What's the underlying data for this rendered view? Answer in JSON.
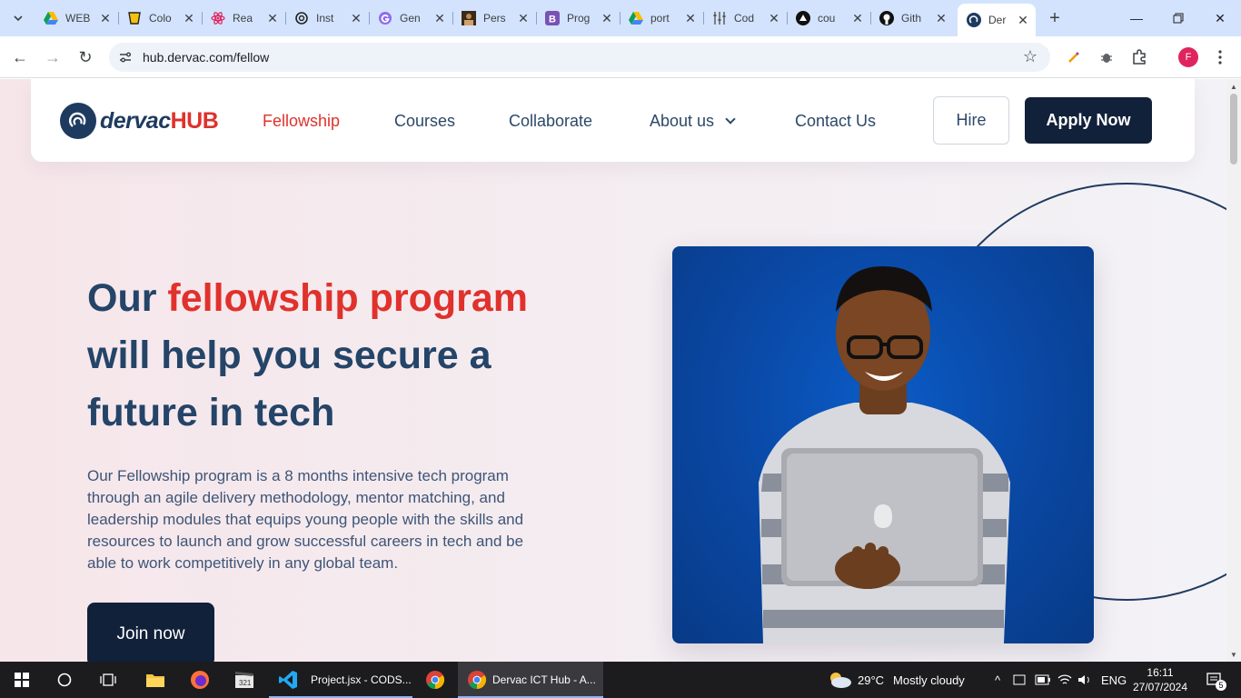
{
  "browser": {
    "tabs": [
      {
        "title": "WEB",
        "icon": "drive-icon"
      },
      {
        "title": "Colo",
        "icon": "cup-icon"
      },
      {
        "title": "Rea",
        "icon": "react-icon"
      },
      {
        "title": "Inst",
        "icon": "openai-icon"
      },
      {
        "title": "Gen",
        "icon": "g-icon"
      },
      {
        "title": "Pers",
        "icon": "portrait-icon"
      },
      {
        "title": "Prog",
        "icon": "bootstrap-icon"
      },
      {
        "title": "port",
        "icon": "drive-icon"
      },
      {
        "title": "Cod",
        "icon": "sliders-icon"
      },
      {
        "title": "cou",
        "icon": "triangle-icon"
      },
      {
        "title": "Gith",
        "icon": "github-icon"
      },
      {
        "title": "Der",
        "icon": "dervac-icon",
        "active": true
      }
    ],
    "url": "hub.dervac.com/fellow",
    "profile_initial": "F"
  },
  "site": {
    "logo": {
      "part1": "dervac",
      "part2": "HUB"
    },
    "nav": {
      "fellowship": "Fellowship",
      "courses": "Courses",
      "collaborate": "Collaborate",
      "about": "About us",
      "contact": "Contact Us"
    },
    "hire_label": "Hire",
    "apply_label": "Apply Now",
    "hero": {
      "headline_pre": "Our ",
      "headline_accent": "fellowship program",
      "headline_post": " will help you secure a future in tech",
      "description": "Our Fellowship program is a 8 months intensive tech program through an agile delivery methodology, mentor matching, and leadership modules that equips young people with the skills and resources to launch and grow successful careers in tech and be able to work competitively in any global team.",
      "join_label": "Join now"
    },
    "colors": {
      "accent": "#e0312c",
      "navy": "#12213a",
      "text": "#244468"
    }
  },
  "taskbar": {
    "apps": [
      {
        "label": "Project.jsx - CODS..."
      },
      {
        "label": "Dervac ICT Hub - A..."
      }
    ],
    "weather": {
      "temp": "29°C",
      "condition": "Mostly cloudy"
    },
    "language": "ENG",
    "time": "16:11",
    "date": "27/07/2024",
    "notifications": "5"
  }
}
